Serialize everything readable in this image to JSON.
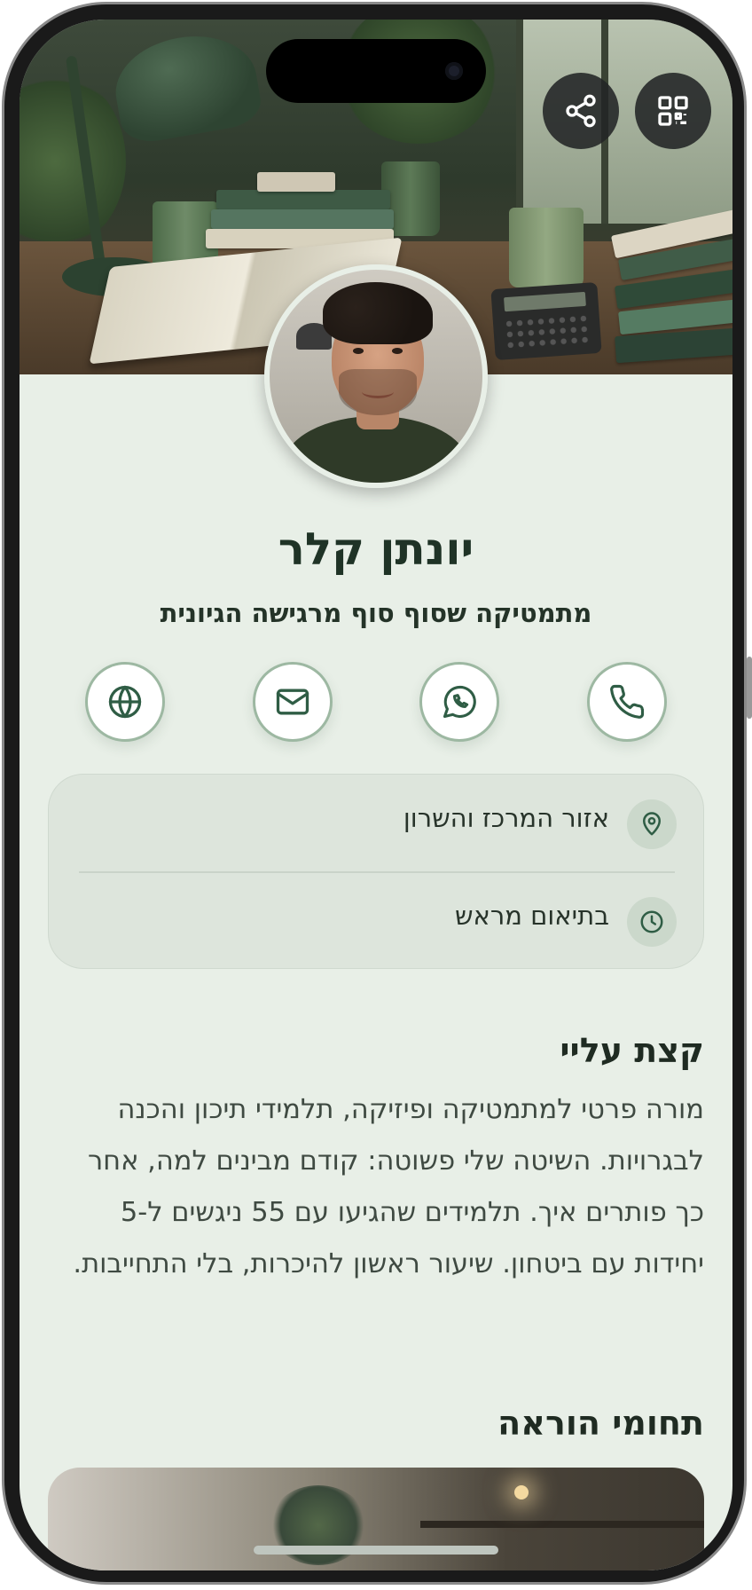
{
  "profile": {
    "name": "יונתן קלר",
    "tagline": "מתמטיקה שסוף סוף מרגישה הגיונית"
  },
  "top_actions": {
    "share_icon": "share-icon",
    "qr_icon": "qr-code-icon"
  },
  "contact_actions": [
    {
      "icon": "phone-icon"
    },
    {
      "icon": "whatsapp-icon"
    },
    {
      "icon": "mail-icon"
    },
    {
      "icon": "globe-icon"
    }
  ],
  "info": {
    "location": "אזור המרכז והשרון",
    "hours": "בתיאום מראש"
  },
  "about": {
    "title": "קצת עליי",
    "text": "מורה פרטי למתמטיקה ופיזיקה, תלמידי תיכון והכנה לבגרויות. השיטה שלי פשוטה: קודם מבינים למה, אחר כך פותרים איך. תלמידים שהגיעו עם 55 ניגשים ל-5 יחידות עם ביטחון. שיעור ראשון להיכרות, בלי התחייבות."
  },
  "teaching": {
    "title": "תחומי הוראה"
  },
  "colors": {
    "accent": "#2f5d45",
    "background": "#e8efe7",
    "card": "#dde5dc",
    "heading": "#1f3326"
  }
}
